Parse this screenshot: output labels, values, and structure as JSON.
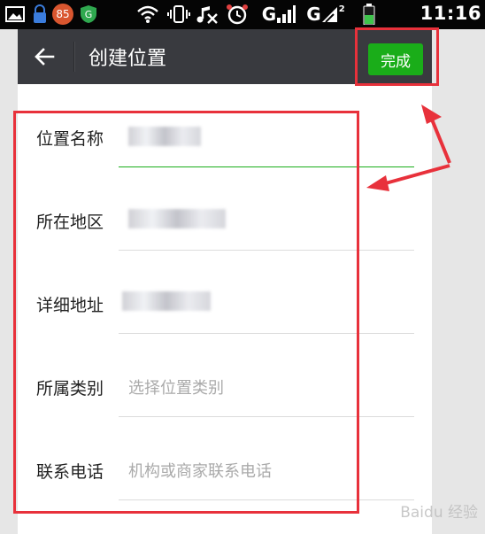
{
  "status_bar": {
    "time": "11:16",
    "badge_count": "85",
    "network_label_1": "G",
    "network_label_2": "G",
    "network_superscript": "2"
  },
  "title_bar": {
    "title": "创建位置",
    "done_label": "完成"
  },
  "form": {
    "rows": [
      {
        "label": "位置名称",
        "value": "",
        "placeholder": ""
      },
      {
        "label": "所在地区",
        "value": "",
        "placeholder": ""
      },
      {
        "label": "详细地址",
        "value": "",
        "placeholder": ""
      },
      {
        "label": "所属类别",
        "value": "",
        "placeholder": "选择位置类别"
      },
      {
        "label": "联系电话",
        "value": "",
        "placeholder": "机构或商家联系电话"
      }
    ]
  },
  "watermark": "Baidu 经验",
  "colors": {
    "accent_green": "#1aad19",
    "titlebar": "#393a3f",
    "annotation_red": "#e8313b"
  }
}
